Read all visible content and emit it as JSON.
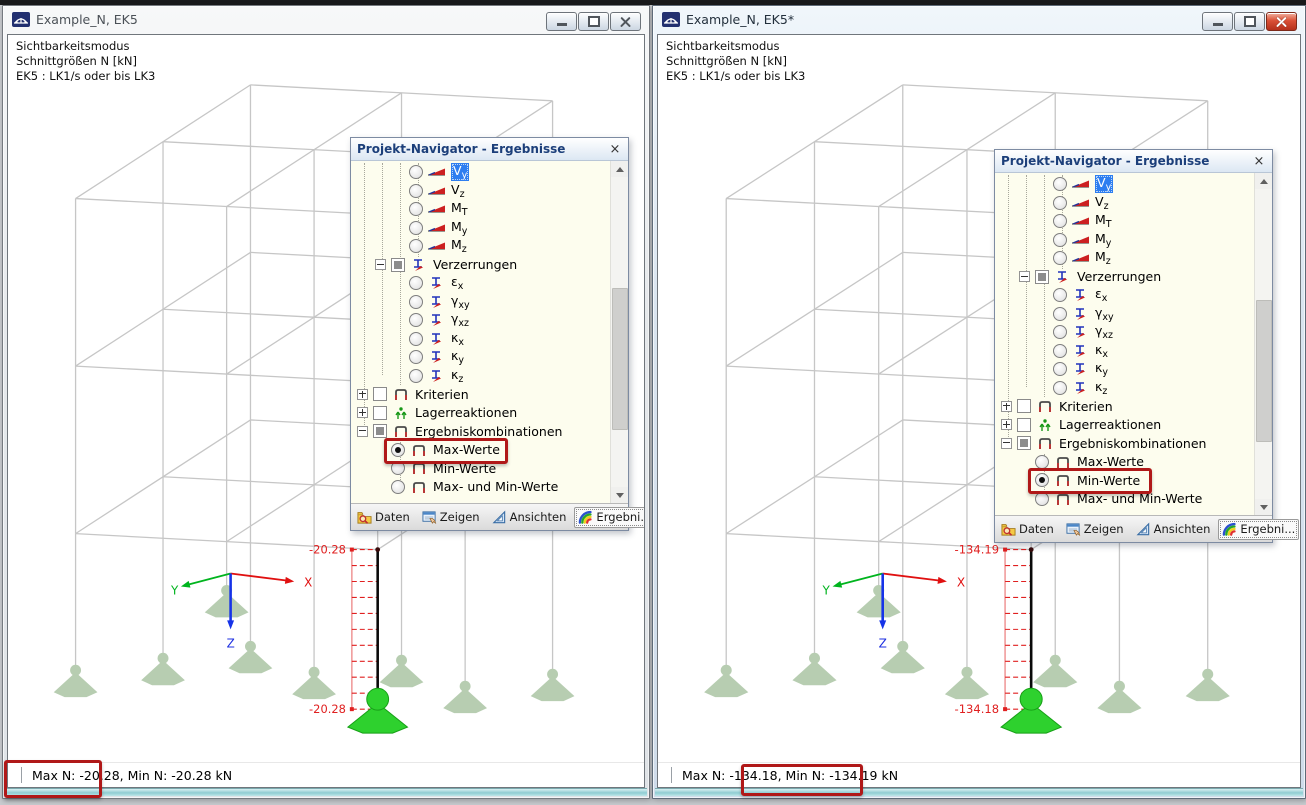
{
  "windows": [
    {
      "title": "Example_N, EK5",
      "active": false,
      "info_lines": [
        "Sichtbarkeitsmodus",
        "Schnittgrößen N [kN]",
        "EK5 : LK1/s oder bis LK3"
      ],
      "status_text": "Max N: -20.28, Min N: -20.28 kN",
      "diagram": {
        "top_label": "-20.28",
        "bottom_label": "-20.28"
      },
      "navigator_selected": "Max-Werte",
      "annotations": {
        "navigator_item": "Max-Werte",
        "status_segment": "Max N: -20.28,"
      }
    },
    {
      "title": "Example_N, EK5*",
      "active": true,
      "info_lines": [
        "Sichtbarkeitsmodus",
        "Schnittgrößen N [kN]",
        "EK5 : LK1/s oder bis LK3"
      ],
      "status_text": "Max N: -134.18, Min N: -134.19 kN",
      "diagram": {
        "top_label": "-134.19",
        "bottom_label": "-134.18"
      },
      "navigator_selected": "Min-Werte",
      "annotations": {
        "navigator_item": "Min-Werte",
        "status_segment": "Min N: -134.19 kN"
      }
    }
  ],
  "navigator": {
    "title": "Projekt-Navigator - Ergebnisse",
    "close_icon": "×",
    "tabs": [
      {
        "label": "Daten",
        "icon": "daten-icon",
        "active": false
      },
      {
        "label": "Zeigen",
        "icon": "zeigen-icon",
        "active": false
      },
      {
        "label": "Ansichten",
        "icon": "ansichten-icon",
        "active": false
      },
      {
        "label": "Ergebni...",
        "icon": "ergebnisse-icon",
        "active": true
      }
    ],
    "tree": [
      {
        "id": "vy",
        "control": "radio",
        "icon": "vy-diagram-icon",
        "main": "V",
        "sub": "y",
        "depth": 3,
        "selected_row": true
      },
      {
        "id": "vz",
        "control": "radio",
        "icon": "vz-diagram-icon",
        "main": "V",
        "sub": "z",
        "depth": 3
      },
      {
        "id": "mt",
        "control": "radio",
        "icon": "mt-diagram-icon",
        "main": "M",
        "sub": "T",
        "depth": 3
      },
      {
        "id": "my",
        "control": "radio",
        "icon": "my-diagram-icon",
        "main": "M",
        "sub": "y",
        "depth": 3
      },
      {
        "id": "mz",
        "control": "radio",
        "icon": "mz-diagram-icon",
        "main": "M",
        "sub": "z",
        "depth": 3
      },
      {
        "id": "verzerrungen",
        "control": "checkbox",
        "state": "mixed",
        "expander": "minus",
        "icon": "deformation-icon",
        "label": "Verzerrungen",
        "depth": 1
      },
      {
        "id": "epsilon-x",
        "control": "radio",
        "icon": "deformation-icon",
        "main": "ε",
        "sub": "x",
        "depth": 3
      },
      {
        "id": "gamma-xy",
        "control": "radio",
        "icon": "deformation-icon",
        "main": "γ",
        "sub": "xy",
        "depth": 3
      },
      {
        "id": "gamma-xz",
        "control": "radio",
        "icon": "deformation-icon",
        "main": "γ",
        "sub": "xz",
        "depth": 3
      },
      {
        "id": "kappa-x",
        "control": "radio",
        "icon": "deformation-icon",
        "main": "κ",
        "sub": "x",
        "depth": 3
      },
      {
        "id": "kappa-y",
        "control": "radio",
        "icon": "deformation-icon",
        "main": "κ",
        "sub": "y",
        "depth": 3
      },
      {
        "id": "kappa-z",
        "control": "radio",
        "icon": "deformation-icon",
        "main": "κ",
        "sub": "z",
        "depth": 3
      },
      {
        "id": "kriterien",
        "control": "checkbox",
        "state": "off",
        "expander": "plus",
        "icon": "frame-icon",
        "label": "Kriterien",
        "depth": 0
      },
      {
        "id": "lagerreaktionen",
        "control": "checkbox",
        "state": "off",
        "expander": "plus",
        "icon": "support-reactions-icon",
        "label": "Lagerreaktionen",
        "depth": 0
      },
      {
        "id": "ergebniskombinationen",
        "control": "checkbox",
        "state": "mixed",
        "expander": "minus",
        "icon": "frame-icon",
        "label": "Ergebniskombinationen",
        "depth": 0
      },
      {
        "id": "max-werte",
        "control": "radio",
        "icon": "frame-icon",
        "label": "Max-Werte",
        "depth": 1
      },
      {
        "id": "min-werte",
        "control": "radio",
        "icon": "frame-icon",
        "label": "Min-Werte",
        "depth": 1
      },
      {
        "id": "max-und-min-werte",
        "control": "radio",
        "icon": "frame-icon",
        "label": "Max- und Min-Werte",
        "depth": 1
      }
    ]
  },
  "axes": {
    "x": "X",
    "y": "Y",
    "z": "Z"
  },
  "colors": {
    "diagram_red": "#e02020",
    "envelope_pink": "#f09c9c",
    "member_black": "#0a0a0a",
    "support_green": "#2ed12e",
    "support_pale": "#b7cdb1",
    "wireframe_gray": "#c6c6c6",
    "annotation_red": "#b01818",
    "selection_blue": "#2e7ef0"
  }
}
